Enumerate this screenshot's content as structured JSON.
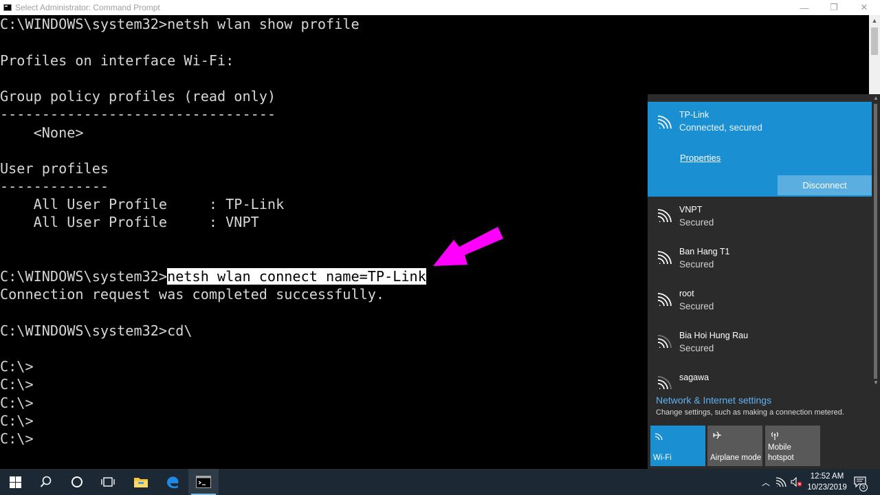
{
  "window": {
    "title": "Select Administrator: Command Prompt",
    "minimize_glyph": "—",
    "restore_glyph": "❐",
    "close_glyph": "✕"
  },
  "console": {
    "lines": [
      "C:\\WINDOWS\\system32>netsh wlan show profile",
      "Profiles on interface Wi-Fi:",
      "Group policy profiles (read only)",
      "---------------------------------",
      "    <None>",
      "User profiles",
      "-------------",
      "    All User Profile     : TP-Link",
      "    All User Profile     : VNPT",
      "C:\\WINDOWS\\system32>",
      "netsh wlan connect name=TP-Link",
      "Connection request was completed successfully.",
      "C:\\WINDOWS\\system32>cd\\",
      "C:\\>",
      "C:\\>",
      "C:\\>",
      "C:\\>",
      "C:\\>"
    ]
  },
  "annotation": {
    "color": "#ff00ff",
    "icon": "arrow-icon"
  },
  "flyout": {
    "connected": {
      "name": "TP-Link",
      "status": "Connected, secured",
      "properties_label": "Properties",
      "disconnect_label": "Disconnect"
    },
    "networks": [
      {
        "name": "VNPT",
        "status": "Secured"
      },
      {
        "name": "Ban Hang T1",
        "status": "Secured"
      },
      {
        "name": "root",
        "status": "Secured"
      },
      {
        "name": "Bia Hoi Hung Rau",
        "status": "Secured"
      },
      {
        "name": "sagawa",
        "status": ""
      }
    ],
    "settings_link": "Network & Internet settings",
    "settings_desc": "Change settings, such as making a connection metered.",
    "tiles": [
      {
        "label": "Wi-Fi",
        "active": true,
        "icon": "wifi-icon"
      },
      {
        "label": "Airplane mode",
        "active": false,
        "icon": "airplane-icon"
      },
      {
        "label": "Mobile\nhotspot",
        "active": false,
        "icon": "hotspot-icon"
      }
    ],
    "accent_color": "#1a8fd1"
  },
  "taskbar": {
    "time": "12:52 AM",
    "date": "10/23/2019",
    "notification_count": "3"
  }
}
